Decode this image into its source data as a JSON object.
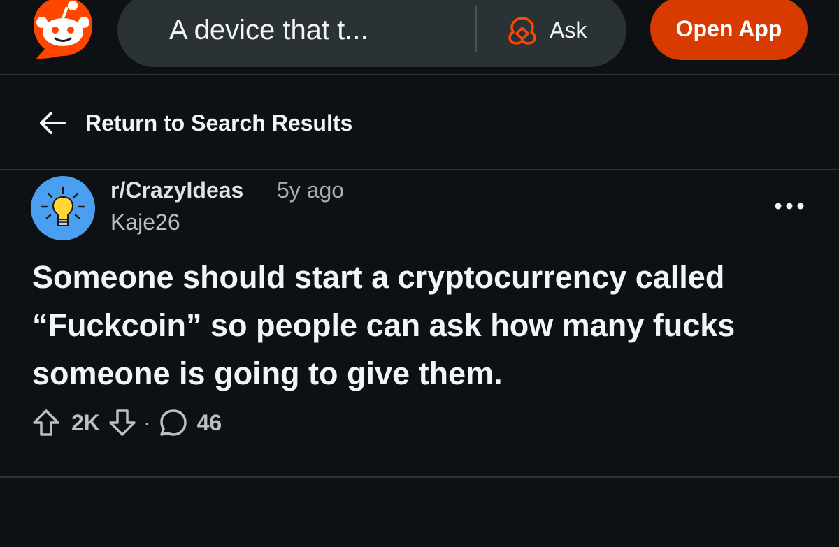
{
  "header": {
    "search_query": "A device that t...",
    "ask_label": "Ask",
    "open_app_label": "Open App",
    "brand_color": "#ff4500",
    "open_app_color": "#d93a00"
  },
  "nav": {
    "back_label": "Return to Search Results"
  },
  "post": {
    "subreddit": "r/CrazyIdeas",
    "age": "5y ago",
    "author": "Kaje26",
    "title": "Someone should start a cryptocurrency called “Fuckcoin” so people can ask how many fucks someone is going to give them.",
    "upvotes": "2K",
    "separator": "·",
    "comments": "46"
  },
  "icons": {
    "logo": "reddit-snoo-icon",
    "ask": "reddit-answers-icon",
    "back": "arrow-left-icon",
    "avatar": "lightbulb-icon",
    "more": "more-horizontal-icon",
    "upvote": "upvote-arrow-icon",
    "downvote": "downvote-arrow-icon",
    "comment": "comment-bubble-icon"
  }
}
